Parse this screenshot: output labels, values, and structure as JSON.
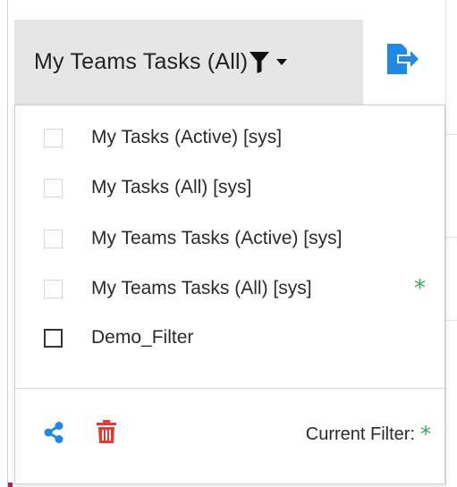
{
  "toolbar": {
    "filter_button_label": "My Teams Tasks (All)",
    "filter_icon": "funnel-icon",
    "caret_icon": "caret-down-icon",
    "export_icon": "export-icon",
    "accent_color": "#1e88e5"
  },
  "dropdown": {
    "items": [
      {
        "label": "My Tasks (Active) [sys]",
        "checked": false,
        "is_current": false
      },
      {
        "label": "My Tasks (All) [sys]",
        "checked": false,
        "is_current": false
      },
      {
        "label": "My Teams Tasks (Active) [sys]",
        "checked": false,
        "is_current": false
      },
      {
        "label": "My Teams Tasks (All) [sys]",
        "checked": false,
        "is_current": true,
        "current_marker": "*"
      },
      {
        "label": "Demo_Filter",
        "checked": false,
        "is_current": false
      }
    ],
    "footer": {
      "share_icon": "share-icon",
      "delete_icon": "trash-icon",
      "current_filter_label": "Current Filter:",
      "current_filter_marker": "*",
      "share_color": "#1e88e5",
      "delete_color": "#e53935",
      "marker_color": "#3aa856"
    }
  }
}
